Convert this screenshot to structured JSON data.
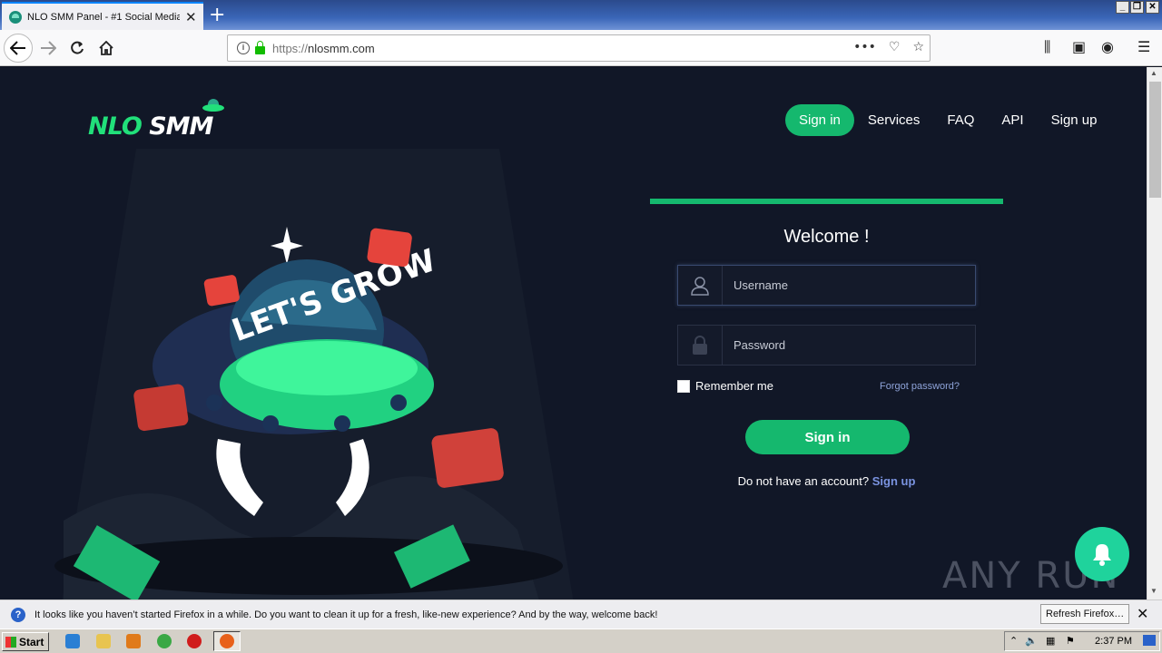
{
  "browser": {
    "tab_title": "NLO SMM Panel - #1 Social Media",
    "tab_close": "✕",
    "new_tab": "+",
    "url_scheme": "https://",
    "url_host": "nlosmm.com",
    "window_controls": [
      "_",
      "❐",
      "✕"
    ]
  },
  "site": {
    "logo_text_1": "NLO",
    "logo_text_2": "SMM",
    "nav": {
      "signin": "Sign in",
      "services": "Services",
      "faq": "FAQ",
      "api": "API",
      "signup": "Sign up"
    },
    "hero_text": "LET'S GROW",
    "accent_color": "#15b86e"
  },
  "login": {
    "welcome": "Welcome !",
    "username_placeholder": "Username",
    "password_placeholder": "Password",
    "remember_label": "Remember me",
    "forgot_label": "Forgot password?",
    "submit_label": "Sign in",
    "no_account_text": "Do not have an account?",
    "signup_link": "Sign up"
  },
  "notification": {
    "message": "It looks like you haven’t started Firefox in a while. Do you want to clean it up for a fresh, like-new experience? And by the way, welcome back!",
    "refresh_button": "Refresh Firefox…",
    "close": "✕"
  },
  "taskbar": {
    "start": "Start",
    "clock": "2:37 PM"
  },
  "watermark": "ANY RUN"
}
